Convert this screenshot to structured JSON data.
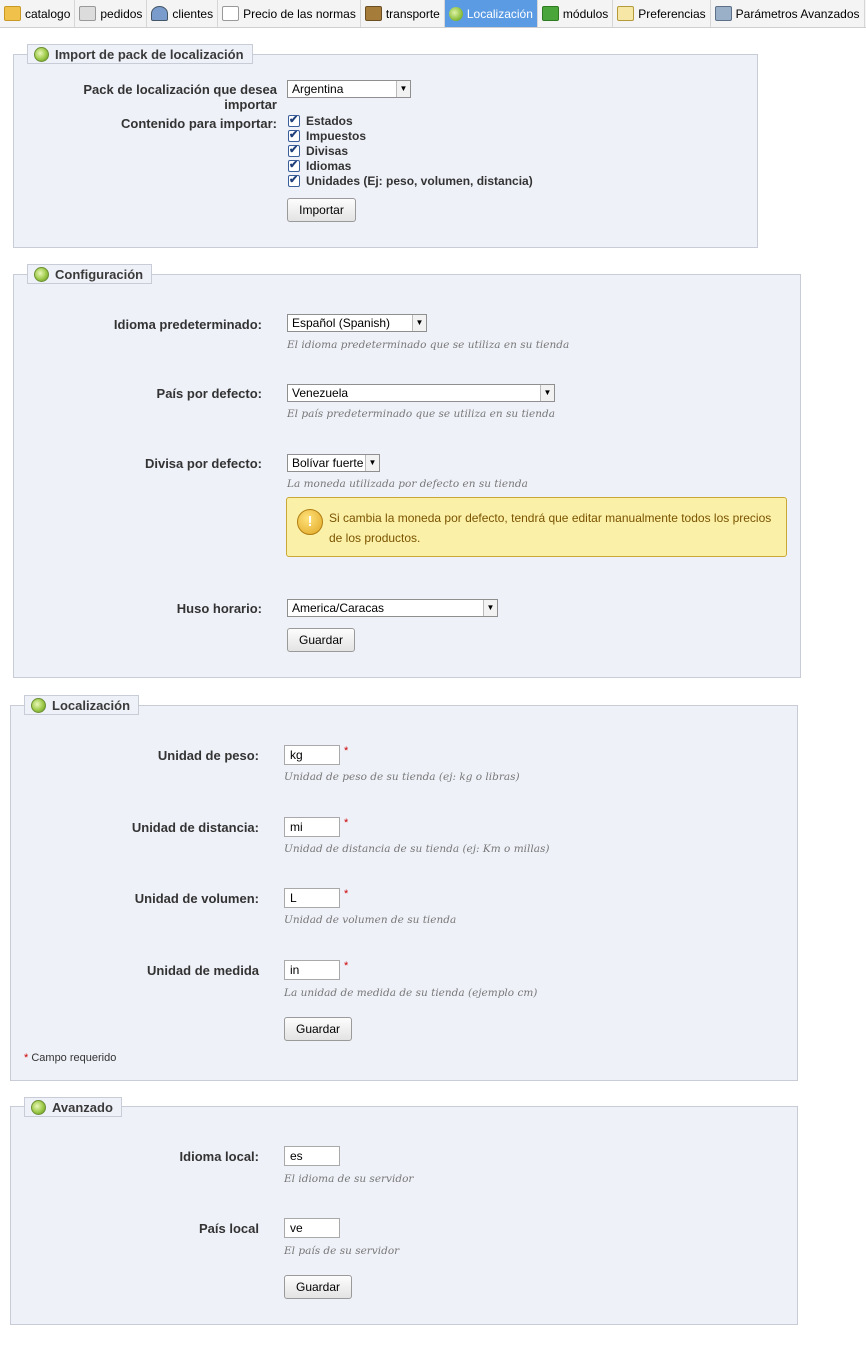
{
  "tabs": [
    {
      "label": "catalogo",
      "icon": "folder-icon"
    },
    {
      "label": "pedidos",
      "icon": "cart-icon"
    },
    {
      "label": "clientes",
      "icon": "user-icon"
    },
    {
      "label": "Precio de las normas",
      "icon": "price-rules-icon"
    },
    {
      "label": "transporte",
      "icon": "truck-icon"
    },
    {
      "label": "Localización",
      "icon": "globe-icon",
      "active": true
    },
    {
      "label": "módulos",
      "icon": "puzzle-icon"
    },
    {
      "label": "Preferencias",
      "icon": "preferences-icon"
    },
    {
      "label": "Parámetros Avanzados",
      "icon": "wrench-icon"
    }
  ],
  "import_pack": {
    "legend": "Import de pack de localización",
    "pack_label": "Pack de localización que desea importar",
    "pack_value": "Argentina",
    "content_label": "Contenido para importar:",
    "items": [
      "Estados",
      "Impuestos",
      "Divisas",
      "Idiomas",
      "Unidades (Ej: peso, volumen, distancia)"
    ],
    "button": "Importar"
  },
  "configuration": {
    "legend": "Configuración",
    "language_label": "Idioma predeterminado:",
    "language_value": "Español (Spanish)",
    "language_hint": "El idioma predeterminado que se utiliza en su tienda",
    "country_label": "País por defecto:",
    "country_value": "Venezuela",
    "country_hint": "El país predeterminado que se utiliza en su tienda",
    "currency_label": "Divisa por defecto:",
    "currency_value": "Bolívar fuerte",
    "currency_hint": "La moneda utilizada por defecto en su tienda",
    "warning": "Si cambia la moneda por defecto, tendrá que editar manualmente todos los precios de los productos.",
    "timezone_label": "Huso horario:",
    "timezone_value": "America/Caracas",
    "button": "Guardar"
  },
  "localization": {
    "legend": "Localización",
    "weight_label": "Unidad de peso:",
    "weight_value": "kg",
    "weight_hint": "Unidad de peso de su tienda (ej: kg o libras)",
    "distance_label": "Unidad de distancia:",
    "distance_value": "mi",
    "distance_hint": "Unidad de distancia de su tienda (ej: Km o millas)",
    "volume_label": "Unidad de volumen:",
    "volume_value": "L",
    "volume_hint": "Unidad de volumen de su tienda",
    "dimension_label": "Unidad de medida",
    "dimension_value": "in",
    "dimension_hint": "La unidad de medida de su tienda (ejemplo cm)",
    "required_mark": "*",
    "button": "Guardar",
    "required_note": "Campo requerido"
  },
  "advanced": {
    "legend": "Avanzado",
    "local_language_label": "Idioma local:",
    "local_language_value": "es",
    "local_language_hint": "El idioma de su servidor",
    "local_country_label": "País local",
    "local_country_value": "ve",
    "local_country_hint": "El país de su servidor",
    "button": "Guardar"
  }
}
